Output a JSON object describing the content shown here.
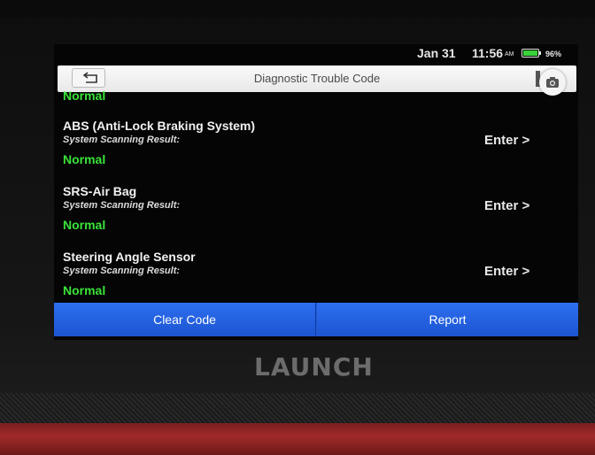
{
  "status_bar": {
    "date": "Jan 31",
    "time": "11:56",
    "ampm": "AM",
    "battery": "96%"
  },
  "header": {
    "title": "Diagnostic Trouble Code",
    "icons": [
      "back-icon",
      "camera-icon"
    ]
  },
  "systems": {
    "previous_status": "Normal",
    "items": [
      {
        "name": "ABS (Anti-Lock Braking System)",
        "result_label": "System Scanning Result:",
        "status": "Normal",
        "action": "Enter >"
      },
      {
        "name": "SRS-Air Bag",
        "result_label": "System Scanning Result:",
        "status": "Normal",
        "action": "Enter >"
      },
      {
        "name": "Steering Angle Sensor",
        "result_label": "System Scanning Result:",
        "status": "Normal",
        "action": "Enter >"
      }
    ]
  },
  "footer": {
    "clear_code": "Clear Code",
    "report": "Report"
  },
  "device": {
    "brand": "LAUNCH"
  },
  "colors": {
    "normal": "#39e339",
    "action_bar": "#1f5bd8",
    "screen_bg": "#050505"
  }
}
